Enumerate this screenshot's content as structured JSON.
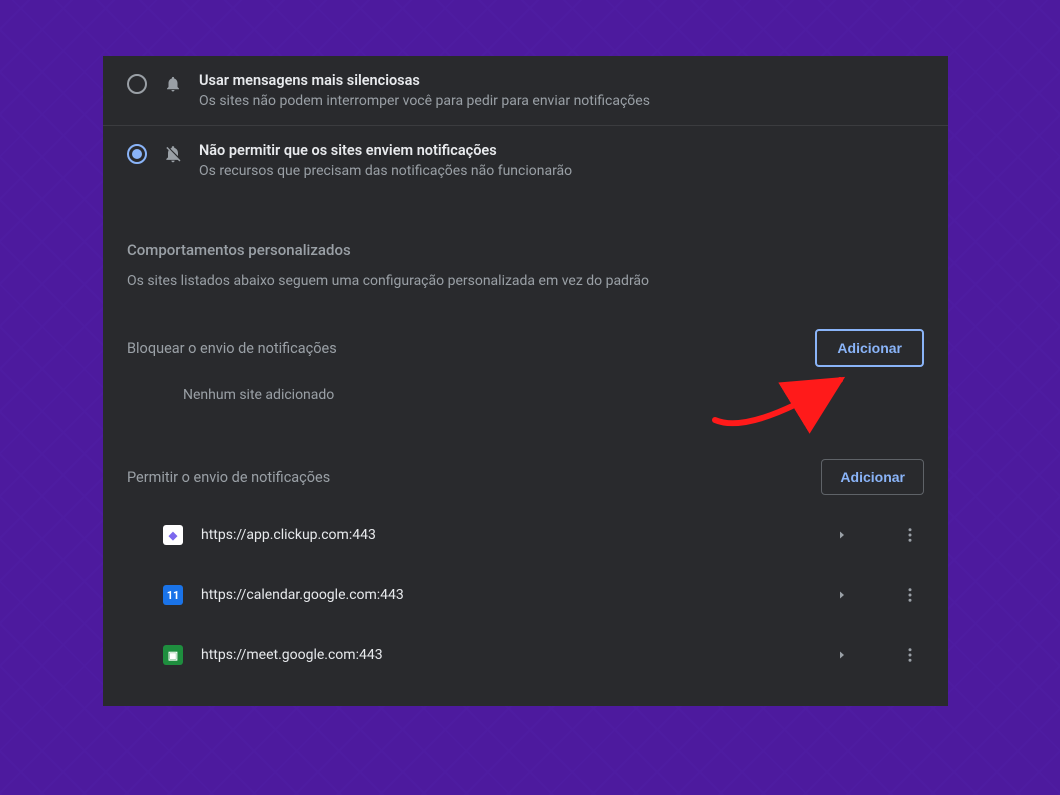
{
  "options": {
    "quiet": {
      "title": "Usar mensagens mais silenciosas",
      "desc": "Os sites não podem interromper você para pedir para enviar notificações",
      "selected": false
    },
    "block": {
      "title": "Não permitir que os sites enviem notificações",
      "desc": "Os recursos que precisam das notificações não funcionarão",
      "selected": true
    }
  },
  "custom_section": {
    "heading": "Comportamentos personalizados",
    "subtext": "Os sites listados abaixo seguem uma configuração personalizada em vez do padrão"
  },
  "block_section": {
    "label": "Bloquear o envio de notificações",
    "add_button": "Adicionar",
    "empty": "Nenhum site adicionado"
  },
  "allow_section": {
    "label": "Permitir o envio de notificações",
    "add_button": "Adicionar",
    "sites": [
      {
        "url": "https://app.clickup.com:443",
        "favicon": "clickup"
      },
      {
        "url": "https://calendar.google.com:443",
        "favicon": "gcal"
      },
      {
        "url": "https://meet.google.com:443",
        "favicon": "meet"
      }
    ]
  }
}
